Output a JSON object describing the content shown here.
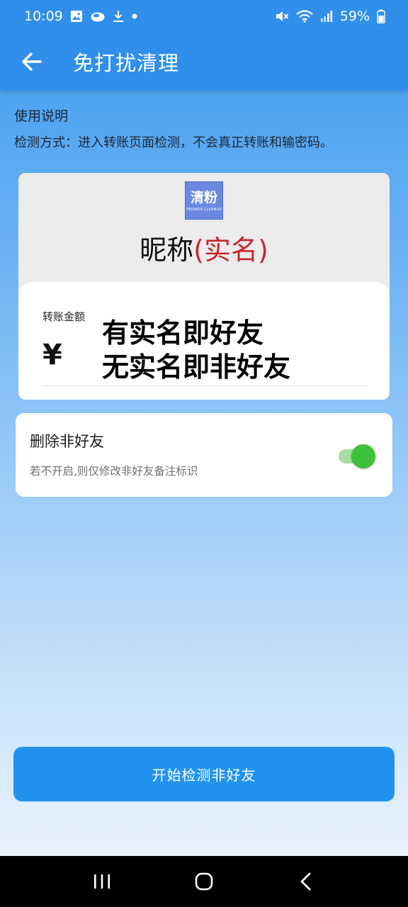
{
  "status_bar": {
    "time": "10:09",
    "battery_percent": "59%",
    "left_icons": [
      "gallery-icon",
      "cloud-icon",
      "download-icon",
      "dot-icon"
    ],
    "right_icons": [
      "mute-icon",
      "wifi-icon",
      "signal-icon",
      "battery-icon"
    ]
  },
  "app_bar": {
    "back_icon": "arrow-left-icon",
    "title": "免打扰清理"
  },
  "instructions": {
    "heading": "使用说明",
    "text": "检测方式：进入转账页面检测，不会真正转账和输密码。"
  },
  "preview": {
    "logo_text": "清粉",
    "logo_subtext": "FRIENDS CLEANUP",
    "nickname": "昵称",
    "realname": "(实名)",
    "amount_label": "转账金额",
    "currency": "¥",
    "overlay_line1": "有实名即好友",
    "overlay_line2": "无实名即非好友"
  },
  "delete_option": {
    "title": "删除非好友",
    "description": "若不开启,则仅修改非好友备注标识",
    "enabled": true
  },
  "start_button": {
    "label": "开始检测非好友"
  },
  "colors": {
    "primary": "#2f8fea",
    "button": "#2193ee",
    "realname_red": "#c9252d",
    "switch_on": "#3ec13a"
  },
  "nav_bar": {
    "items": [
      "recents-icon",
      "home-icon",
      "back-icon"
    ]
  }
}
